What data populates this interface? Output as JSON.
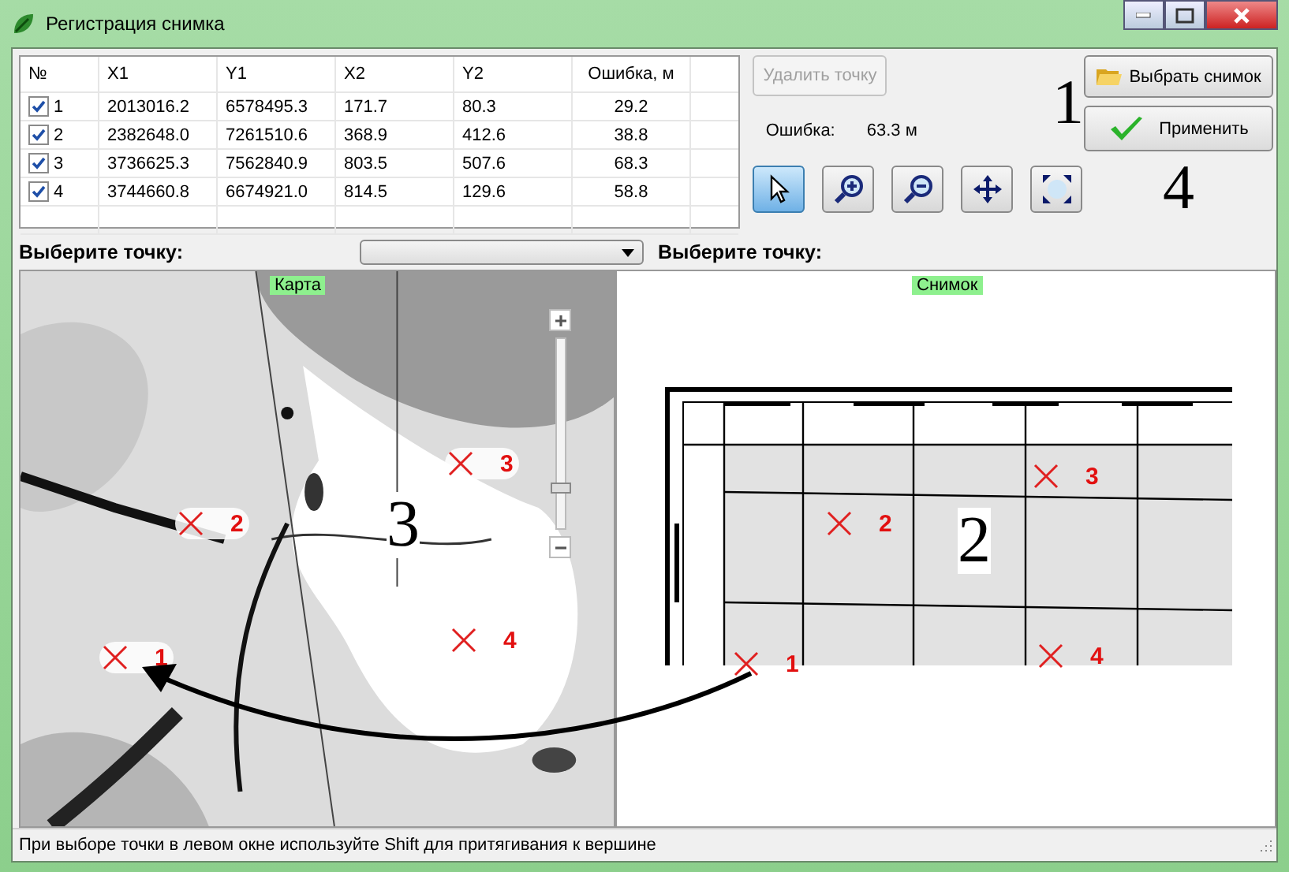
{
  "window": {
    "title": "Регистрация снимка"
  },
  "table": {
    "columns": [
      "№",
      "X1",
      "Y1",
      "X2",
      "Y2",
      "Ошибка, м"
    ],
    "rows": [
      {
        "checked": true,
        "cells": [
          "1",
          "2013016.2",
          "6578495.3",
          "171.7",
          "80.3",
          "29.2"
        ]
      },
      {
        "checked": true,
        "cells": [
          "2",
          "2382648.0",
          "7261510.6",
          "368.9",
          "412.6",
          "38.8"
        ]
      },
      {
        "checked": true,
        "cells": [
          "3",
          "3736625.3",
          "7562840.9",
          "803.5",
          "507.6",
          "68.3"
        ]
      },
      {
        "checked": true,
        "cells": [
          "4",
          "3744660.8",
          "6674921.0",
          "814.5",
          "129.6",
          "58.8"
        ]
      }
    ]
  },
  "delete_button": {
    "label": "Удалить точку",
    "disabled": true
  },
  "error": {
    "label": "Ошибка:",
    "value": "63.3 м"
  },
  "tools": [
    {
      "kind": "pointer",
      "selected": true
    },
    {
      "kind": "zoom-in",
      "selected": false
    },
    {
      "kind": "zoom-out",
      "selected": false
    },
    {
      "kind": "pan",
      "selected": false
    },
    {
      "kind": "fit",
      "selected": false
    }
  ],
  "annotations": [
    "1",
    "4"
  ],
  "choose_image_button": "Выбрать снимок",
  "apply_button": "Применить",
  "map": {
    "prompt": "Выберите точку:",
    "label": "Карта",
    "zoom": {
      "level": 0.2
    },
    "annotation": "3",
    "markers": [
      {
        "label": "1"
      },
      {
        "label": "2"
      },
      {
        "label": "3"
      },
      {
        "label": "4"
      }
    ]
  },
  "image": {
    "prompt": "Выберите точку:",
    "label": "Снимок",
    "annotation": "2",
    "markers": [
      {
        "label": "1"
      },
      {
        "label": "2"
      },
      {
        "label": "3"
      },
      {
        "label": "4"
      }
    ]
  },
  "status_bar": "При выборе точки в левом окне используйте Shift для притягивания к вершине"
}
